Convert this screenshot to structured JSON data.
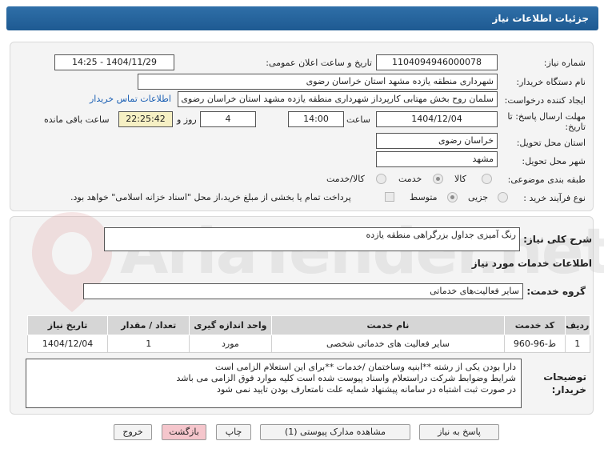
{
  "header": {
    "title": "جزئیات اطلاعات نیاز"
  },
  "form": {
    "need_number_label": "شماره نیاز:",
    "need_number": "1104094946000078",
    "announce_label": "تاریخ و ساعت اعلان عمومی:",
    "announce_value": "1404/11/29 - 14:25",
    "buyer_label": "نام دستگاه خریدار:",
    "buyer_value": "شهرداری منطقه یازده مشهد استان خراسان رضوی",
    "creator_label": "ایجاد کننده درخواست:",
    "creator_value": "سلمان روح بخش مهتابی کارپرداز شهرداری منطقه یازده مشهد استان خراسان رضوی",
    "contact_link": "اطلاعات تماس خریدار",
    "deadline_label": "مهلت ارسال پاسخ: تا",
    "deadline_label2": "تاریخ:",
    "deadline_date": "1404/12/04",
    "time_label": "ساعت",
    "deadline_time": "14:00",
    "days_value": "4",
    "days_label": "روز و",
    "remaining_time": "22:25:42",
    "remaining_label": "ساعت باقی مانده",
    "province_label": "استان محل تحویل:",
    "province_value": "خراسان رضوی",
    "city_label": "شهر محل تحویل:",
    "city_value": "مشهد",
    "category_label": "طبقه بندی موضوعی:",
    "category_options": [
      "کالا",
      "خدمت",
      "کالا/خدمت"
    ],
    "category_selected": "خدمت",
    "process_label": "نوع فرآیند خرید :",
    "process_options": [
      "جزیی",
      "متوسط"
    ],
    "process_selected": "متوسط",
    "payment_note": "پرداخت تمام یا بخشی از مبلغ خرید،از محل \"اسناد خزانه اسلامی\" خواهد بود."
  },
  "summary": {
    "label": "شرح کلی نیاز:",
    "value": "رنگ آمیزی جداول بزرگراهی منطقه یازده"
  },
  "services": {
    "section_title": "اطلاعات خدمات مورد نیاز",
    "group_label": "گروه خدمت:",
    "group_value": "سایر فعالیت‌های خدماتی",
    "columns": [
      "ردیف",
      "کد خدمت",
      "نام خدمت",
      "واحد اندازه گیری",
      "تعداد / مقدار",
      "تاریخ نیاز"
    ],
    "rows": [
      {
        "index": "1",
        "code": "ط-96-960",
        "name": "سایر فعالیت های خدماتی شخصی",
        "unit": "مورد",
        "qty": "1",
        "date": "1404/12/04"
      }
    ]
  },
  "notes": {
    "label1": "توضیحات",
    "label2": "خریدار:",
    "lines": [
      "دارا بودن یکی از رشته **ابنیه وساختمان /خدمات **برای این استعلام الزامی است",
      " شرایط وضوابط شرکت دراستعلام واسناد پیوست شده است کلیه موارد فوق الزامی می باشد",
      "در صورت ثبت اشتباه در سامانه پیشنهاد شمایه علت نامتعارف بودن تایید نمی شود"
    ]
  },
  "buttons": {
    "reply": "پاسخ به نیاز",
    "attachments": "مشاهده مدارک پیوستی (1)",
    "print": "چاپ",
    "back": "بازگشت",
    "exit": "خروج"
  },
  "watermark": {
    "text": "AriaTender.net"
  },
  "colors": {
    "header": "#1e5a92",
    "link": "#1a5fb4",
    "remaining_bg": "#f6f0c4",
    "back_button": "#f5c6cc"
  }
}
